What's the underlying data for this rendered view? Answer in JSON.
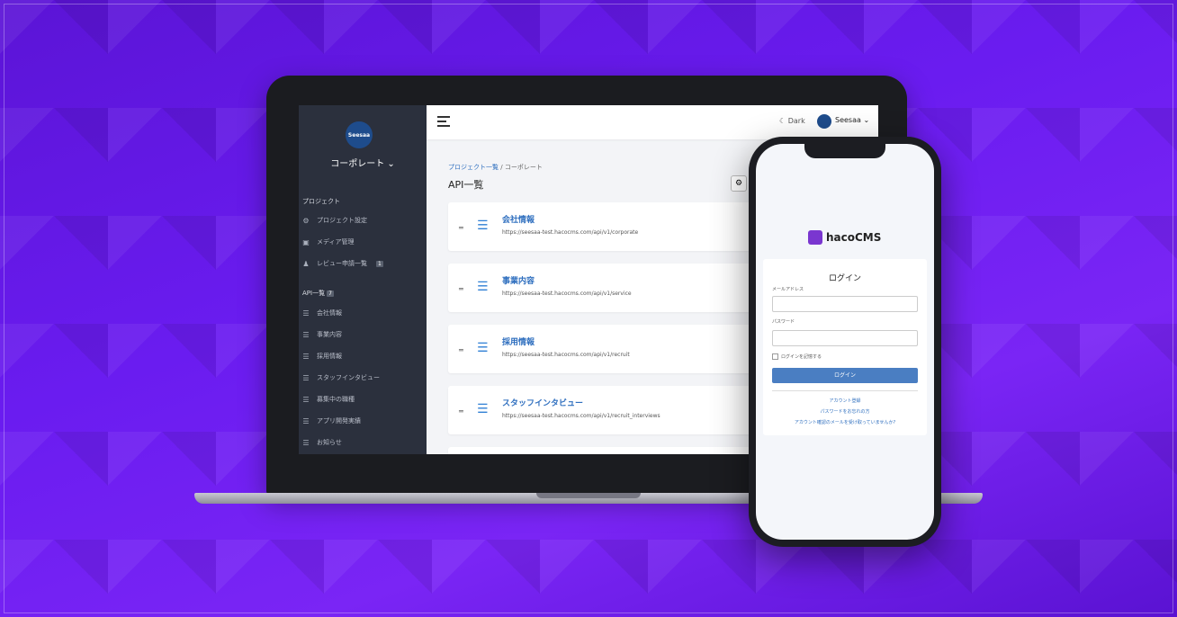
{
  "colors": {
    "accent": "#2f6fbf",
    "sidebar": "#2b303d",
    "background": "#6a1cf0"
  },
  "sidebar": {
    "logo_text": "Seesaa",
    "project_name": "コーポレート",
    "project_heading": "プロジェクト",
    "project_items": [
      {
        "icon": "gear-icon",
        "label": "プロジェクト設定"
      },
      {
        "icon": "media-icon",
        "label": "メディア管理"
      },
      {
        "icon": "user-icon",
        "label": "レビュー申請一覧",
        "badge": "1"
      }
    ],
    "api_heading": "API一覧",
    "api_badge": "7",
    "api_items": [
      "会社情報",
      "事業内容",
      "採用情報",
      "スタッフインタビュー",
      "募集中の職種",
      "アプリ開発実績",
      "お知らせ"
    ]
  },
  "topbar": {
    "dark_label": "Dark",
    "user_name": "Seesaa"
  },
  "main": {
    "breadcrumb_root": "プロジェクト一覧",
    "breadcrumb_sep": "/",
    "breadcrumb_current": "コーポレート",
    "title": "API一覧",
    "apis": [
      {
        "name": "会社情報",
        "url": "https://seesaa-test.hacocms.com/api/v1/corporate"
      },
      {
        "name": "事業内容",
        "url": "https://seesaa-test.hacocms.com/api/v1/service"
      },
      {
        "name": "採用情報",
        "url": "https://seesaa-test.hacocms.com/api/v1/recruit"
      },
      {
        "name": "スタッフインタビュー",
        "url": "https://seesaa-test.hacocms.com/api/v1/recruit_interviews"
      }
    ]
  },
  "phone": {
    "logo_text": "hacoCMS",
    "login_title": "ログイン",
    "email_label": "メールアドレス",
    "password_label": "パスワード",
    "remember_label": "ログインを記憶する",
    "login_button": "ログイン",
    "register_link": "アカウント登録",
    "forgot_link": "パスワードをお忘れの方",
    "confirm_link": "アカウント確認のメールを受け取っていませんか?"
  }
}
